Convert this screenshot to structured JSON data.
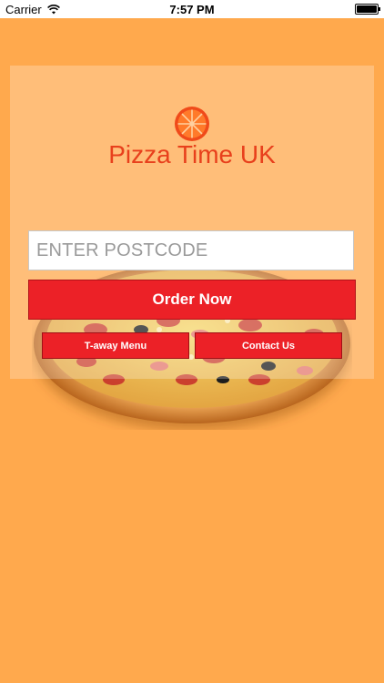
{
  "status_bar": {
    "carrier": "Carrier",
    "time": "7:57 PM"
  },
  "brand": {
    "title": "Pizza Time UK"
  },
  "form": {
    "postcode_placeholder": "ENTER POSTCODE",
    "postcode_value": "",
    "order_label": "Order Now"
  },
  "links": {
    "menu_label": "T-away Menu",
    "contact_label": "Contact Us"
  },
  "colors": {
    "background": "#FFA94D",
    "brand_text": "#E8401C",
    "button": "#EC2127"
  },
  "icons": [
    "wifi-icon",
    "battery-icon",
    "orange-slice-logo-icon",
    "pizza-image"
  ]
}
